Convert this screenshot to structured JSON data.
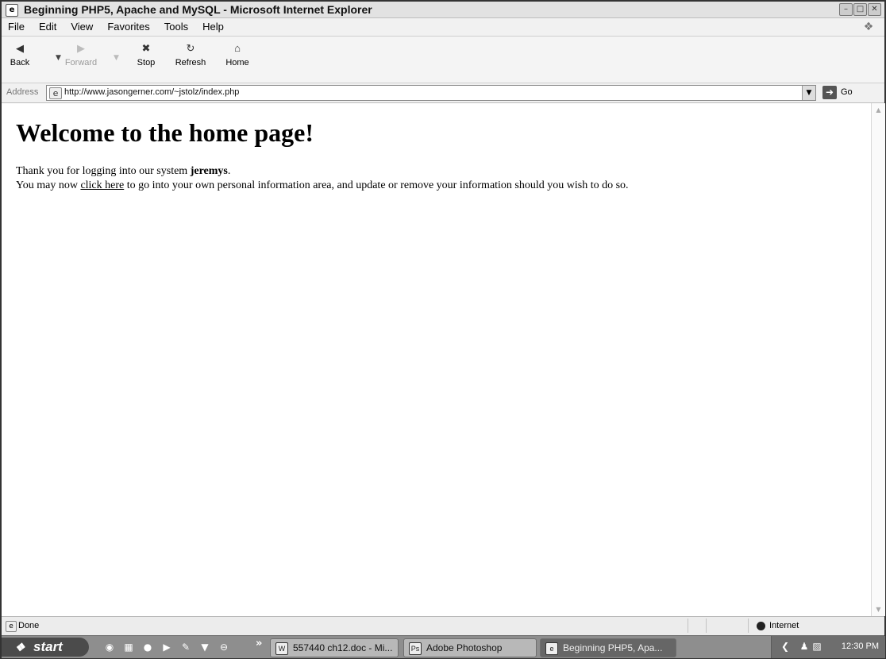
{
  "window": {
    "title": "Beginning PHP5, Apache and MySQL - Microsoft Internet Explorer",
    "controls": [
      "minimize-icon",
      "maximize-icon",
      "close-icon"
    ]
  },
  "menubar": {
    "items": [
      "File",
      "Edit",
      "View",
      "Favorites",
      "Tools",
      "Help"
    ]
  },
  "toolbar": {
    "back_label": "Back",
    "forward_label": "Forward",
    "stop_label": "Stop",
    "refresh_label": "Refresh",
    "home_label": "Home",
    "icons": [
      "back-arrow-icon",
      "forward-arrow-icon",
      "stop-icon",
      "refresh-icon",
      "home-icon"
    ]
  },
  "address": {
    "label": "Address",
    "url": "http://www.jasongerner.com/~jstolz/index.php",
    "go_label": "Go"
  },
  "page": {
    "heading": "Welcome to the home page!",
    "line1_prefix": "Thank you for logging into our system ",
    "username": "jeremys",
    "line1_suffix": ".",
    "line2_prefix": "You may now ",
    "link_text": "click here",
    "line2_suffix": " to go into your own personal information area, and update or remove your information should you wish to do so."
  },
  "statusbar": {
    "status": "Done",
    "zone": "Internet"
  },
  "taskbar": {
    "start_label": "start",
    "overflow_chevron": "»",
    "tasks": [
      {
        "label": "557440 ch12.doc - Mi...",
        "icon": "word-document-icon",
        "active": false
      },
      {
        "label": "Adobe Photoshop",
        "icon": "photoshop-icon",
        "active": false
      },
      {
        "label": "Beginning PHP5, Apa...",
        "icon": "internet-explorer-icon",
        "active": true
      }
    ],
    "clock": "12:30 PM"
  },
  "colors": {
    "titlebar": "#e2e2e2",
    "taskbar": "#8e8e8e",
    "active_task": "#666666",
    "start_button": "#4b4b4b"
  }
}
